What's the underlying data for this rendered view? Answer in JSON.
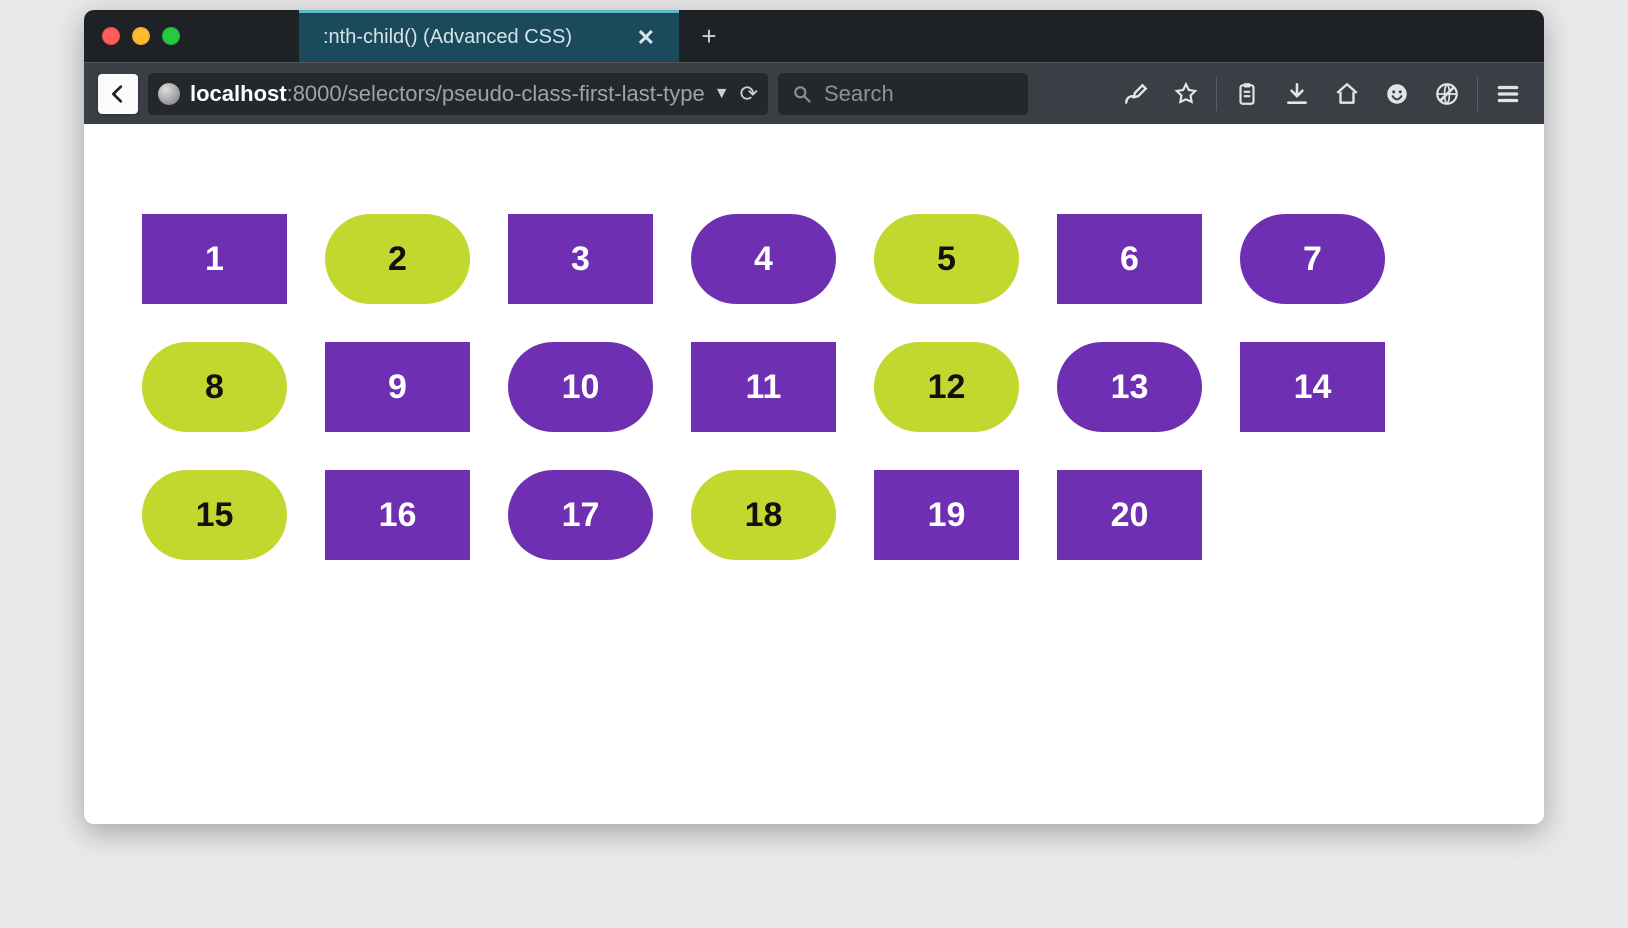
{
  "window": {
    "tab_title": ":nth-child() (Advanced CSS)"
  },
  "url": {
    "host": "localhost",
    "path": ":8000/selectors/pseudo-class-first-last-type"
  },
  "search": {
    "placeholder": "Search"
  },
  "boxes": [
    {
      "n": "1",
      "shape": "rect",
      "color": "purple"
    },
    {
      "n": "2",
      "shape": "pill",
      "color": "lime"
    },
    {
      "n": "3",
      "shape": "rect",
      "color": "purple"
    },
    {
      "n": "4",
      "shape": "pill",
      "color": "purple"
    },
    {
      "n": "5",
      "shape": "pill",
      "color": "lime"
    },
    {
      "n": "6",
      "shape": "rect",
      "color": "purple"
    },
    {
      "n": "7",
      "shape": "pill",
      "color": "purple"
    },
    {
      "n": "8",
      "shape": "pill",
      "color": "lime"
    },
    {
      "n": "9",
      "shape": "rect",
      "color": "purple"
    },
    {
      "n": "10",
      "shape": "pill",
      "color": "purple"
    },
    {
      "n": "11",
      "shape": "rect",
      "color": "purple"
    },
    {
      "n": "12",
      "shape": "pill",
      "color": "lime"
    },
    {
      "n": "13",
      "shape": "pill",
      "color": "purple"
    },
    {
      "n": "14",
      "shape": "rect",
      "color": "purple"
    },
    {
      "n": "15",
      "shape": "pill",
      "color": "lime"
    },
    {
      "n": "16",
      "shape": "rect",
      "color": "purple"
    },
    {
      "n": "17",
      "shape": "pill",
      "color": "purple"
    },
    {
      "n": "18",
      "shape": "pill",
      "color": "lime"
    },
    {
      "n": "19",
      "shape": "rect",
      "color": "purple"
    },
    {
      "n": "20",
      "shape": "rect",
      "color": "purple"
    }
  ]
}
